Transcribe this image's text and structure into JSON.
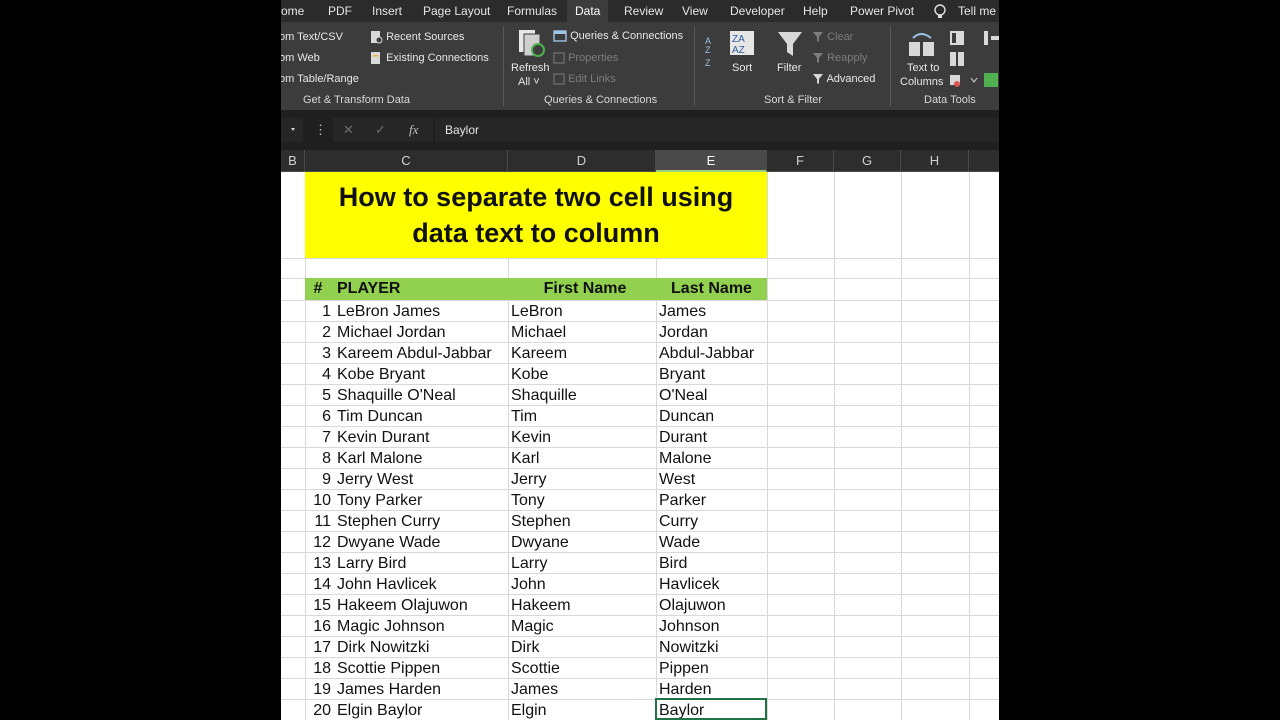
{
  "ribbon": {
    "tabs": [
      "ome",
      "PDF",
      "Insert",
      "Page Layout",
      "Formulas",
      "Data",
      "Review",
      "View",
      "Developer",
      "Help",
      "Power Pivot",
      "Tell me w"
    ],
    "active_tab": "Data",
    "get_transform": {
      "from_text": "om Text/CSV",
      "from_web": "om Web",
      "from_table": "om Table/Range",
      "recent_sources": "Recent Sources",
      "existing_connections": "Existing Connections",
      "group": "Get & Transform Data"
    },
    "queries": {
      "refresh": "Refresh",
      "all": "All",
      "queries_connections": "Queries & Connections",
      "properties": "Properties",
      "edit_links": "Edit Links",
      "group": "Queries & Connections"
    },
    "sort_filter": {
      "sort": "Sort",
      "filter": "Filter",
      "clear": "Clear",
      "reapply": "Reapply",
      "advanced": "Advanced",
      "group": "Sort & Filter"
    },
    "data_tools": {
      "text_to": "Text to",
      "columns": "Columns",
      "group": "Data Tools"
    }
  },
  "formula_bar": {
    "value": "Baylor",
    "fx": "fx"
  },
  "columns": [
    "B",
    "C",
    "D",
    "E",
    "F",
    "G",
    "H"
  ],
  "selected_column": "E",
  "sheet": {
    "title_line1": "How to separate two cell using",
    "title_line2": "data text to column",
    "headers": {
      "num": "#",
      "player": "PLAYER",
      "first": "First Name",
      "last": "Last Name"
    },
    "rows": [
      {
        "n": "1",
        "player": "LeBron James",
        "first": "LeBron",
        "last": "James"
      },
      {
        "n": "2",
        "player": "Michael Jordan",
        "first": "Michael",
        "last": "Jordan"
      },
      {
        "n": "3",
        "player": "Kareem Abdul-Jabbar",
        "first": "Kareem",
        "last": "Abdul-Jabbar"
      },
      {
        "n": "4",
        "player": "Kobe Bryant",
        "first": "Kobe",
        "last": "Bryant"
      },
      {
        "n": "5",
        "player": "Shaquille O'Neal",
        "first": "Shaquille",
        "last": "O'Neal"
      },
      {
        "n": "6",
        "player": "Tim Duncan",
        "first": "Tim",
        "last": "Duncan"
      },
      {
        "n": "7",
        "player": "Kevin Durant",
        "first": "Kevin",
        "last": "Durant"
      },
      {
        "n": "8",
        "player": "Karl Malone",
        "first": "Karl",
        "last": "Malone"
      },
      {
        "n": "9",
        "player": "Jerry West",
        "first": "Jerry",
        "last": "West"
      },
      {
        "n": "10",
        "player": "Tony Parker",
        "first": "Tony",
        "last": "Parker"
      },
      {
        "n": "11",
        "player": "Stephen Curry",
        "first": "Stephen",
        "last": "Curry"
      },
      {
        "n": "12",
        "player": "Dwyane Wade",
        "first": "Dwyane",
        "last": "Wade"
      },
      {
        "n": "13",
        "player": "Larry Bird",
        "first": "Larry",
        "last": "Bird"
      },
      {
        "n": "14",
        "player": "John Havlicek",
        "first": "John",
        "last": "Havlicek"
      },
      {
        "n": "15",
        "player": "Hakeem Olajuwon",
        "first": "Hakeem",
        "last": "Olajuwon"
      },
      {
        "n": "16",
        "player": "Magic Johnson",
        "first": "Magic",
        "last": "Johnson"
      },
      {
        "n": "17",
        "player": "Dirk Nowitzki",
        "first": "Dirk",
        "last": "Nowitzki"
      },
      {
        "n": "18",
        "player": "Scottie Pippen",
        "first": "Scottie",
        "last": "Pippen"
      },
      {
        "n": "19",
        "player": "James Harden",
        "first": "James",
        "last": "Harden"
      },
      {
        "n": "20",
        "player": "Elgin Baylor",
        "first": "Elgin",
        "last": "Baylor"
      }
    ]
  },
  "colors": {
    "title_fill": "#ffff00",
    "header_fill": "#92d050",
    "selection": "#217346"
  }
}
